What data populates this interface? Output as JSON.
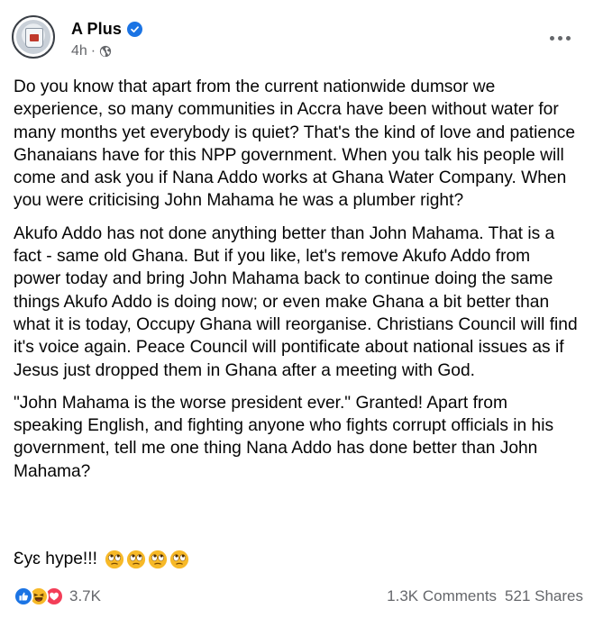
{
  "post": {
    "author": "A Plus",
    "timestamp": "4h",
    "separator": "·",
    "paragraphs": [
      "Do you know that apart from the current nationwide dumsor we experience, so many communities in Accra have been without water for many months yet everybody is quiet? That's the kind of love and patience Ghanaians have for this NPP government. When you talk his people will come and ask you if Nana Addo works at Ghana Water Company. When you were criticising John Mahama he was a plumber right?",
      "Akufo Addo has not done anything better than John Mahama. That is a fact - same old Ghana. But if you like, let's remove Akufo Addo from power today and bring John Mahama back to continue doing the same things Akufo Addo is doing now; or even make Ghana a bit better than what it is today, Occupy Ghana will reorganise. Christians Council will find it's voice again. Peace Council will pontificate about national issues as if Jesus just dropped them in Ghana after a meeting with God.",
      "\"John Mahama is the worse president ever.\" Granted! Apart from speaking English, and fighting anyone who fights corrupt officials in his government, tell me one thing Nana Addo has done better than John Mahama?"
    ],
    "closing_text": "Ɛyɛ hype!!!",
    "closing_emojis": [
      "face-with-rolling-eyes-icon",
      "face-with-rolling-eyes-icon",
      "face-with-rolling-eyes-icon",
      "face-with-rolling-eyes-icon"
    ]
  },
  "footer": {
    "reaction_icons": [
      "like-icon",
      "haha-icon",
      "love-icon"
    ],
    "reaction_count": "3.7K",
    "comments": "1.3K Comments",
    "shares": "521 Shares"
  },
  "colors": {
    "accent": "#1b74e4",
    "secondary_text": "#65676b",
    "primary_text": "#050505"
  }
}
